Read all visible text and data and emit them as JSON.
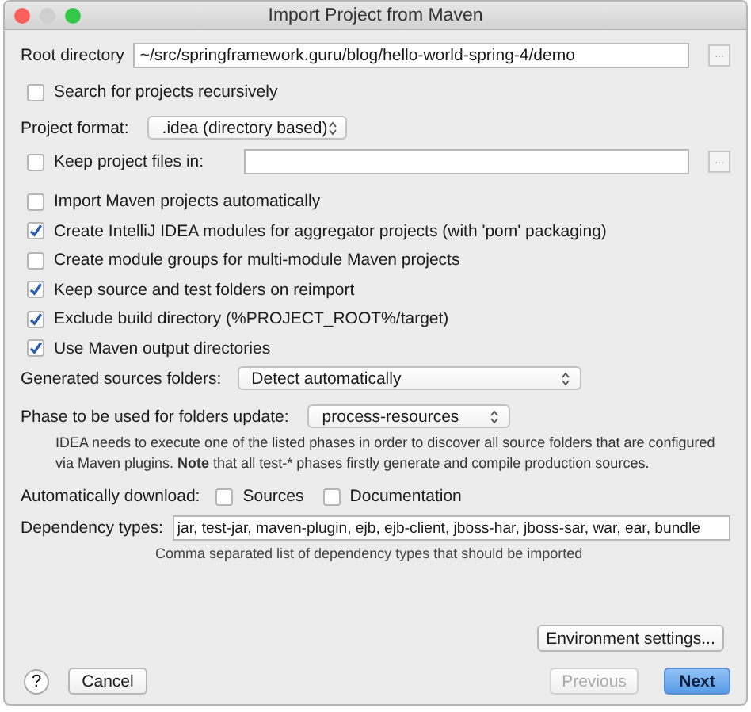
{
  "window": {
    "title": "Import Project from Maven"
  },
  "root_directory": {
    "label": "Root directory",
    "value": "~/src/springframework.guru/blog/hello-world-spring-4/demo",
    "browse": "..."
  },
  "search_recursively": {
    "label": "Search for projects recursively",
    "checked": false
  },
  "project_format": {
    "label": "Project format:",
    "value": ".idea (directory based)"
  },
  "keep_project_files": {
    "label": "Keep project files in:",
    "checked": false,
    "browse": "..."
  },
  "options": [
    {
      "label": "Import Maven projects automatically",
      "checked": false
    },
    {
      "label": "Create IntelliJ IDEA modules for aggregator projects (with 'pom' packaging)",
      "checked": true
    },
    {
      "label": "Create module groups for multi-module Maven projects",
      "checked": false
    },
    {
      "label": "Keep source and test folders on reimport",
      "checked": true
    },
    {
      "label": "Exclude build directory (%PROJECT_ROOT%/target)",
      "checked": true
    },
    {
      "label": "Use Maven output directories",
      "checked": true
    }
  ],
  "generated_sources": {
    "label": "Generated sources folders:",
    "value": "Detect automatically"
  },
  "phase": {
    "label": "Phase to be used for folders update:",
    "value": "process-resources",
    "note": "IDEA needs to execute one of the listed phases in order to discover all source folders that are configured via Maven plugins. **Note** that all test-* phases firstly generate and compile production sources."
  },
  "auto_download": {
    "label": "Automatically download:",
    "options": [
      {
        "label": "Sources",
        "checked": false
      },
      {
        "label": "Documentation",
        "checked": false
      }
    ]
  },
  "dependency_types": {
    "label": "Dependency types:",
    "value": "jar, test-jar, maven-plugin, ejb, ejb-client, jboss-har, jboss-sar, war, ear, bundle",
    "hint": "Comma separated list of dependency types that should be imported"
  },
  "environment_button": {
    "label": "Environment settings..."
  },
  "footer": {
    "help": "?",
    "buttons": [
      {
        "label": "Cancel",
        "kind": "normal",
        "disabled": false
      },
      {
        "label": "Previous",
        "kind": "normal",
        "disabled": true
      },
      {
        "label": "Next",
        "kind": "default",
        "disabled": false
      }
    ]
  }
}
